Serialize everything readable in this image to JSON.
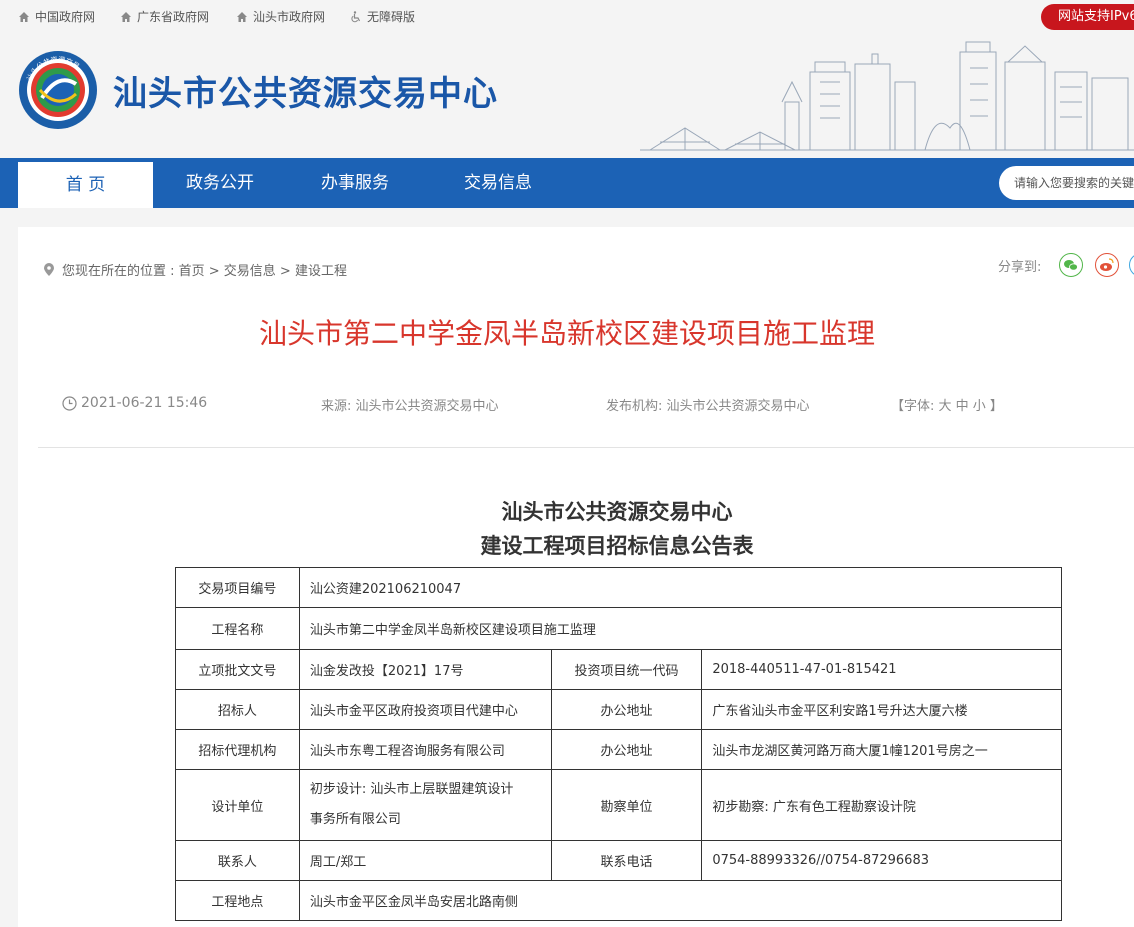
{
  "topbar": {
    "links": [
      "中国政府网",
      "广东省政府网",
      "汕头市政府网",
      "无障碍版"
    ],
    "ipv6_badge": "网站支持IPv6"
  },
  "header": {
    "site_name": "汕头市公共资源交易中心",
    "logo_text": "汕头公共资源交易"
  },
  "nav": {
    "items": [
      "首 页",
      "政务公开",
      "办事服务",
      "交易信息"
    ],
    "active": "首 页",
    "search_placeholder": "请输入您要搜索的关键词"
  },
  "breadcrumb": {
    "text": "您现在所在的位置 : 首页 > 交易信息 > 建设工程"
  },
  "share": {
    "label": "分享到:",
    "icons": [
      "wechat-icon",
      "weibo-icon",
      "qzone-icon"
    ]
  },
  "article": {
    "title": "汕头市第二中学金凤半岛新校区建设项目施工监理",
    "date": "2021-06-21 15:46",
    "source": "来源:  汕头市公共资源交易中心",
    "publisher": "发布机构:  汕头市公共资源交易中心",
    "font_size": "【字体:  大 中 小 】",
    "subtitle_line1": "汕头市公共资源交易中心",
    "subtitle_line2": "建设工程项目招标信息公告表"
  },
  "table": {
    "project_no_label": "交易项目编号",
    "project_no": "汕公资建202106210047",
    "project_name_label": "工程名称",
    "project_name": "汕头市第二中学金凤半岛新校区建设项目施工监理",
    "approval_label": "立项批文文号",
    "approval": "汕金发改投【2021】17号",
    "invest_code_label": "投资项目统一代码",
    "invest_code": "2018-440511-47-01-815421",
    "tenderer_label": "招标人",
    "tenderer": "汕头市金平区政府投资项目代建中心",
    "tenderer_addr_label": "办公地址",
    "tenderer_addr": "广东省汕头市金平区利安路1号升达大厦六楼",
    "agent_label": "招标代理机构",
    "agent": "汕头市东粤工程咨询服务有限公司",
    "agent_addr_label": "办公地址",
    "agent_addr": "汕头市龙湖区黄河路万商大厦1幢1201号房之一",
    "design_label": "设计单位",
    "design_line1": "初步设计:  汕头市上层联盟建筑设计",
    "design_line2": "事务所有限公司",
    "survey_label": "勘察单位",
    "survey": "初步勘察:  广东有色工程勘察设计院",
    "contact_label": "联系人",
    "contact": "周工/郑工",
    "phone_label": "联系电话",
    "phone": "0754-88993326//0754-87296683",
    "location_label": "工程地点",
    "location": "汕头市金平区金凤半岛安居北路南侧"
  },
  "colors": {
    "nav_blue": "#1c62b5",
    "title_red": "#d8362c",
    "site_name_blue": "#1a57a8",
    "badge_red": "#c8161d"
  }
}
